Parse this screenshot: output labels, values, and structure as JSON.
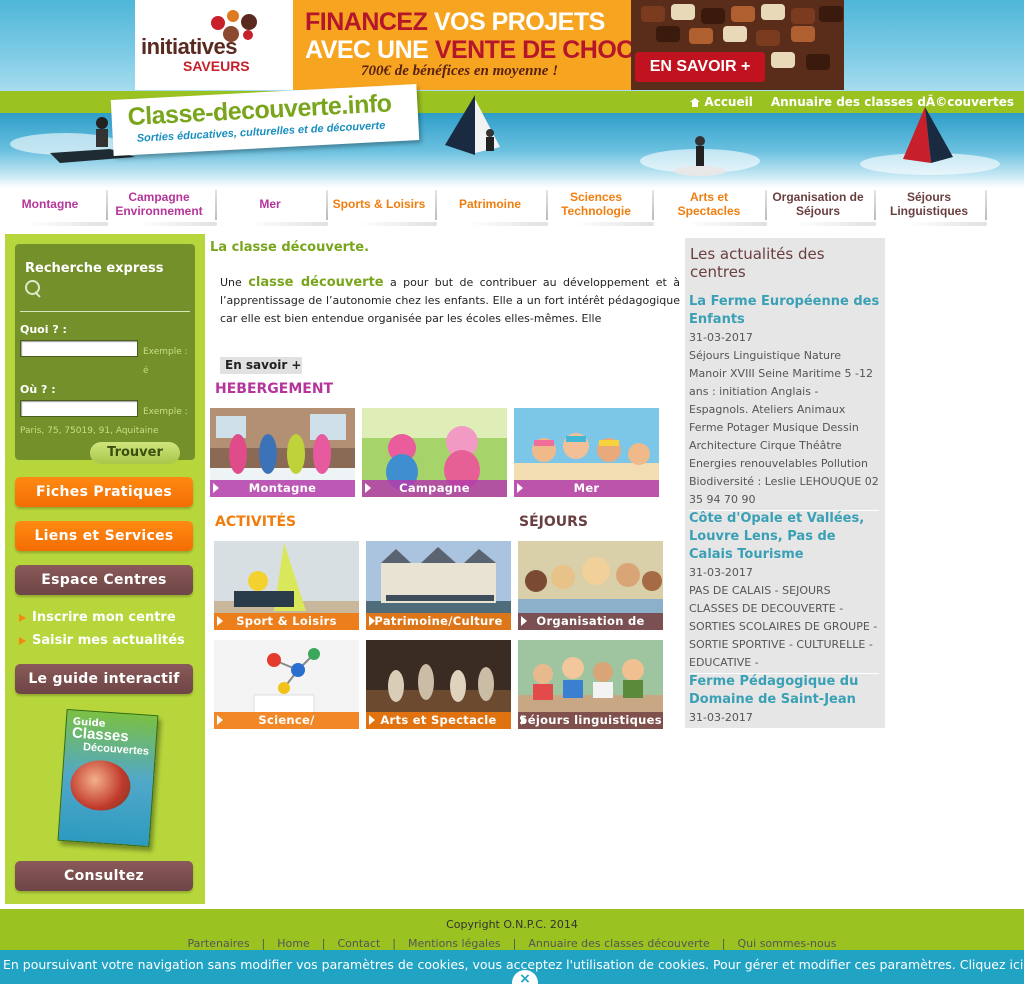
{
  "ad": {
    "logo_line1": "initiatives",
    "logo_line2": "SAVEURS",
    "headline1_a": "FINANCEZ",
    "headline1_b": " VOS PROJETS",
    "headline2_a": "AVEC UNE ",
    "headline2_b": "VENTE DE CHOCOLATS",
    "subline": "700€ de bénéfices en moyenne !",
    "cta": "EN SAVOIR +"
  },
  "topbar": {
    "home": "Accueil",
    "directory": "Annuaire des classes dÃ©couvertes"
  },
  "logo": {
    "title": "Classe-decouverte.info",
    "tagline": "Sorties éducatives, culturelles et de découverte"
  },
  "nav": [
    {
      "label": "Montagne",
      "color": "#b6359a"
    },
    {
      "label": "Campagne Environnement",
      "color": "#b6359a"
    },
    {
      "label": "Mer",
      "color": "#b6359a"
    },
    {
      "label": "Sports & Loisirs",
      "color": "#f07e0f"
    },
    {
      "label": "Patrimoine",
      "color": "#f07e0f"
    },
    {
      "label": "Sciences Technologie",
      "color": "#f07e0f"
    },
    {
      "label": "Arts et Spectacles",
      "color": "#f07e0f"
    },
    {
      "label": "Organisation de Séjours",
      "color": "#6a3f3f"
    },
    {
      "label": "Séjours Linguistiques",
      "color": "#6a3f3f"
    }
  ],
  "search": {
    "title": "Recherche express",
    "what_label": "Quoi ? :",
    "what_example": "Exemple : é",
    "where_label": "Où ?   :",
    "where_example": "Exemple : Paris, 75, 75019, 91, Aquitaine",
    "submit": "Trouver"
  },
  "sidebar": {
    "fiches": "Fiches Pratiques",
    "liens": "Liens et Services",
    "espace": "Espace Centres",
    "inscrire": "Inscrire mon centre",
    "saisir": "Saisir mes actualités",
    "guide": "Le guide interactif",
    "book_small": "Guide",
    "book_title": "Classes",
    "book_sub": "Découvertes",
    "consultez": "Consultez"
  },
  "intro": {
    "title": "La classe découverte.",
    "p_prefix": "Une ",
    "p_highlight": "classe découverte",
    "p_rest": " a pour but de contribuer au développement et à l’apprentissage de l’autonomie chez les enfants. Elle a un fort intérêt pédagogique car elle est bien entendue organisée par les écoles elles-mêmes. Elle",
    "more": "En savoir +"
  },
  "sections": {
    "hebergement": "HEBERGEMENT",
    "activites": "ACTIVITÉS",
    "sejours": "SÉJOURS"
  },
  "tiles": {
    "montagne": "Montagne",
    "campagne": "Campagne",
    "mer": "Mer",
    "sport": "Sport & Loisirs",
    "patrimoine": "Patrimoine/Culture",
    "organisation": "Organisation de",
    "science": "Science/",
    "arts": "Arts et Spectacle",
    "linguistiques": "Séjours linguistiques"
  },
  "news": {
    "heading": "Les actualités des centres",
    "items": [
      {
        "title": "La Ferme Européenne des Enfants",
        "date": "31-03-2017",
        "body": "Séjours Linguistique Nature Manoir XVIII Seine Maritime 5 -12 ans : initiation Anglais - Espagnols. Ateliers Animaux Ferme Potager Musique Dessin Architecture Cirque Théâtre Energies renouvelables Pollution Biodiversité : Leslie LEHOUQUE 02 35 94 70 90"
      },
      {
        "title": "Côte d'Opale et Vallées, Louvre Lens, Pas de Calais Tourisme",
        "date": "31-03-2017",
        "body": "PAS DE CALAIS - SEJOURS CLASSES DE DECOUVERTE - SORTIES SCOLAIRES DE GROUPE - SORTIE SPORTIVE - CULTURELLE - EDUCATIVE -"
      },
      {
        "title": "Ferme Pédagogique du Domaine de Saint-Jean",
        "date": "31-03-2017",
        "body": ""
      }
    ]
  },
  "footer": {
    "copyright": "Copyright O.N.P.C. 2014",
    "links": [
      "Partenaires",
      "Home",
      "Contact",
      "Mentions légales",
      "Annuaire des classes découverte",
      "Qui sommes-nous"
    ],
    "separator": "|"
  },
  "cookie": {
    "text": "En poursuivant votre navigation sans modifier vos paramètres de cookies, vous acceptez l'utilisation de cookies. Pour gérer et modifier ces paramètres.  Cliquez ici",
    "close": "×"
  }
}
